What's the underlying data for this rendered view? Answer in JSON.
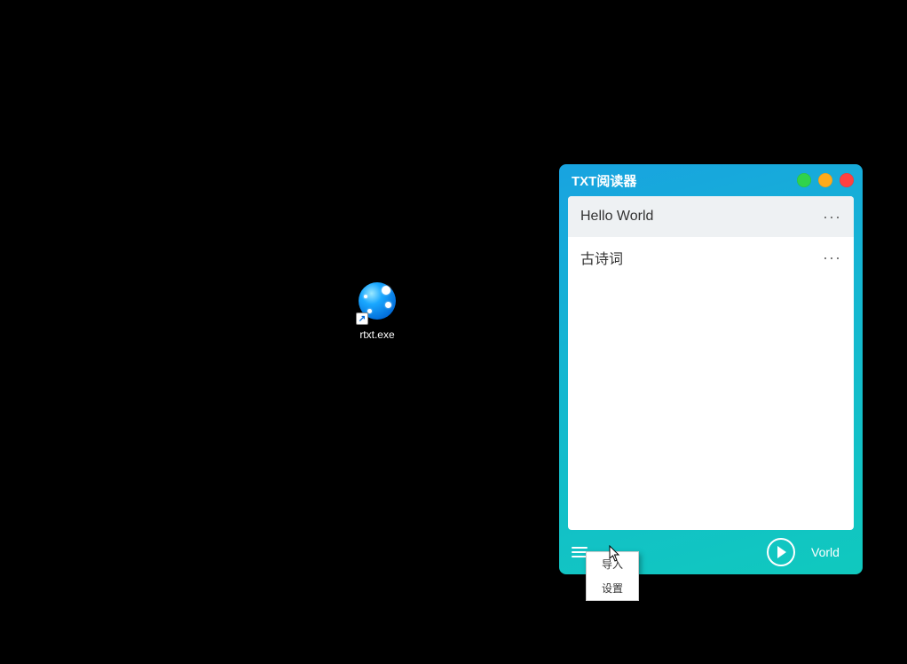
{
  "desktop": {
    "icon_label": "rtxt.exe"
  },
  "app": {
    "title": "TXT阅读器",
    "list": [
      {
        "label": "Hello World",
        "selected": true
      },
      {
        "label": "古诗词",
        "selected": false
      }
    ],
    "now_playing": "Vorld",
    "menu": {
      "import": "导入",
      "settings": "设置"
    }
  }
}
